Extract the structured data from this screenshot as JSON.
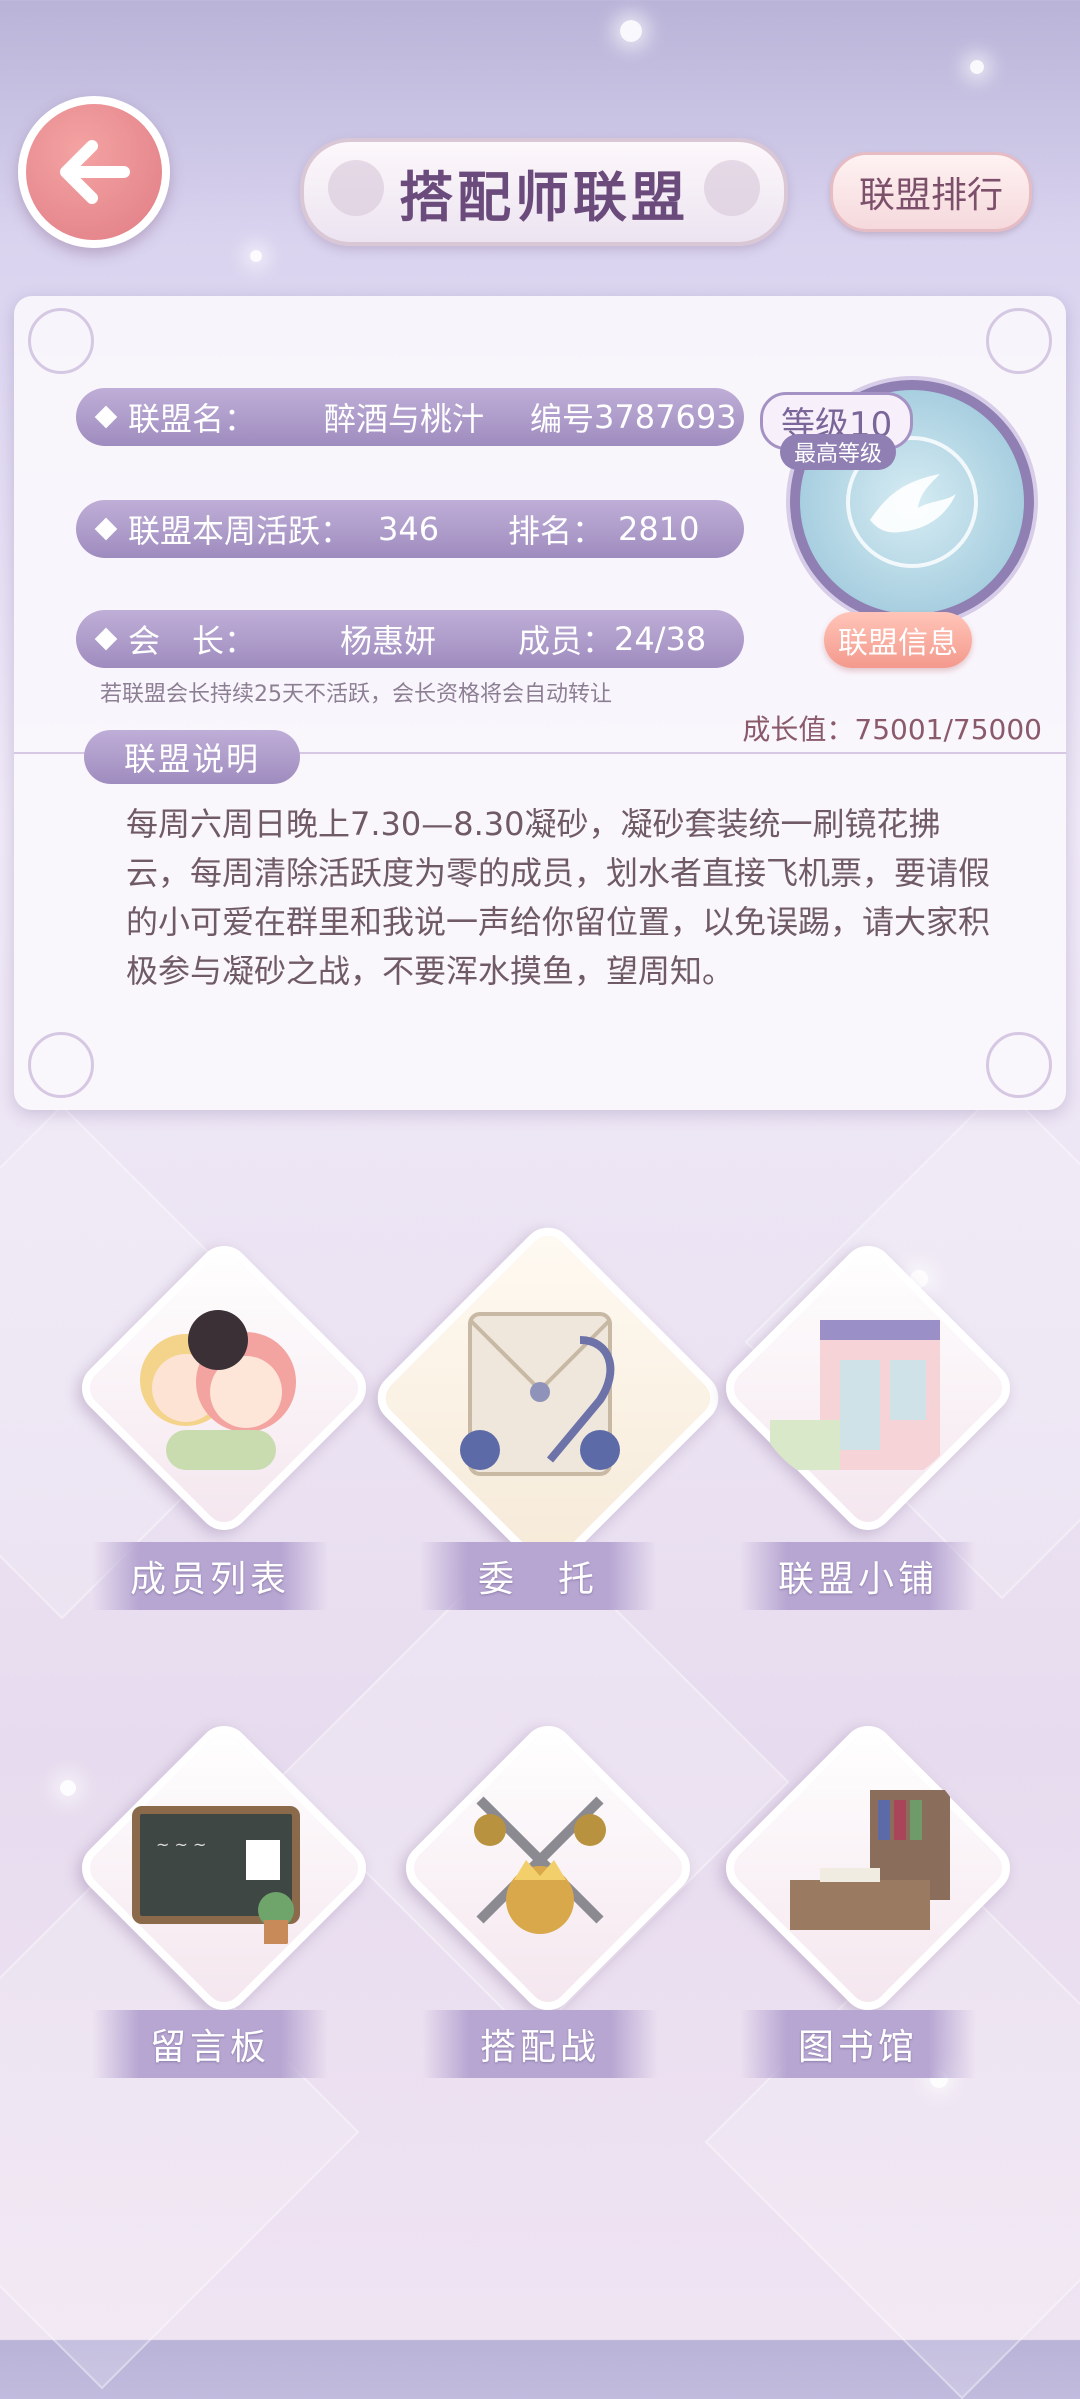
{
  "header": {
    "title": "搭配师联盟",
    "rank_button": "联盟排行"
  },
  "alliance": {
    "name_label": "联盟名：",
    "name_value": "醉酒与桃汁",
    "id_label": "编号",
    "id_value": "3787693",
    "activity_label": "联盟本周活跃：",
    "activity_value": "346",
    "rank_label": "排名：",
    "rank_value": "2810",
    "leader_label": "会　长：",
    "leader_value": "杨惠妍",
    "members_label": "成员：",
    "members_value": "24/38",
    "level": "等级10",
    "level_sub": "最高等级",
    "info_button": "联盟信息",
    "note": "若联盟会长持续25天不活跃，会长资格将会自动转让",
    "growth": "成长值：75001/75000"
  },
  "description": {
    "tag": "联盟说明",
    "text": "每周六周日晚上7.30—8.30凝砂，凝砂套装统一刷镜花拂云，每周清除活跃度为零的成员，划水者直接飞机票，要请假的小可爱在群里和我说一声给你留位置，以免误踢，请大家积极参与凝砂之战，不要浑水摸鱼，望周知。"
  },
  "features": [
    {
      "label": "成员列表",
      "icon": "members-icon"
    },
    {
      "label": "委　托",
      "icon": "commission-icon"
    },
    {
      "label": "联盟小铺",
      "icon": "shop-icon"
    },
    {
      "label": "留言板",
      "icon": "message-board-icon"
    },
    {
      "label": "搭配战",
      "icon": "battle-icon"
    },
    {
      "label": "图书馆",
      "icon": "library-icon"
    }
  ],
  "colors": {
    "accent_purple": "#9f8cbf",
    "back_button": "#e07d85",
    "info_button": "#f4998d"
  }
}
